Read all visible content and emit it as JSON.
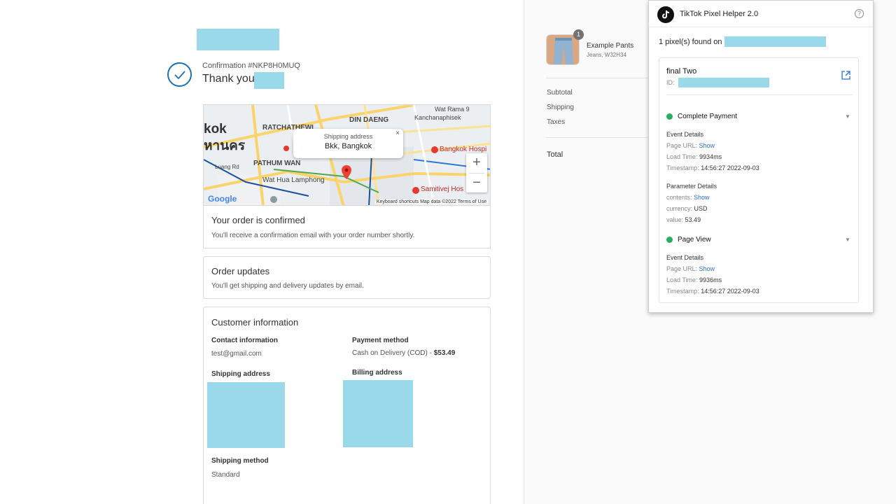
{
  "order": {
    "confirmation": "Confirmation #NKP8H0MUQ",
    "thank_you": "Thank you"
  },
  "map": {
    "popup_label": "Shipping address",
    "popup_value": "Bkk, Bangkok",
    "popup_close": "×",
    "zoom_in": "+",
    "zoom_out": "−",
    "labels": {
      "ratchathewi": "RATCHATHEWI",
      "din_daeng": "DIN DAENG",
      "pathum_wan": "PATHUM WAN",
      "wat_hua_lamphong": "Wat Hua Lamphong",
      "kanchanaphisek": "Kanchanaphisek",
      "wat_rama": "Wat Rama 9",
      "bangkok_hospital": "Bangkok Hospi",
      "samitivej": "Samitivej Hos",
      "kok": "kok",
      "thai_big": "หานคร",
      "luang_rd": "Luang Rd"
    },
    "google": "Google",
    "footer": "Keyboard shortcuts   Map data ©2022   Terms of Use"
  },
  "cards": {
    "confirmed_title": "Your order is confirmed",
    "confirmed_text": "You'll receive a confirmation email with your order number shortly.",
    "updates_title": "Order updates",
    "updates_text": "You'll get shipping and delivery updates by email.",
    "customer_title": "Customer information",
    "contact_label": "Contact information",
    "contact_value": "test@gmail.com",
    "payment_label": "Payment method",
    "payment_value": "Cash on Delivery (COD) - ",
    "payment_amount": "$53.49",
    "shipping_address_label": "Shipping address",
    "billing_address_label": "Billing address",
    "shipping_method_label": "Shipping method",
    "shipping_method_value": "Standard"
  },
  "summary": {
    "badge": "1",
    "product_name": "Example Pants",
    "product_variant": "Jeans, W32H34",
    "subtotal": "Subtotal",
    "shipping": "Shipping",
    "taxes": "Taxes",
    "total": "Total"
  },
  "extension": {
    "title": "TikTok Pixel Helper 2.0",
    "help": "?",
    "found": "1 pixel(s) found on",
    "pixel_name": "final Two",
    "id_label": "ID:",
    "event1": {
      "title": "Complete Payment",
      "event_details": "Event Details",
      "page_url_label": "Page URL:",
      "page_url_value": "Show",
      "load_time_label": "Load Time:",
      "load_time_value": "9934ms",
      "timestamp_label": "Timestamp:",
      "timestamp_value": "14:56:27 2022-09-03",
      "param_details": "Parameter Details",
      "contents_label": "contents:",
      "contents_value": "Show",
      "currency_label": "currency:",
      "currency_value": "USD",
      "value_label": "value:",
      "value_value": "53.49"
    },
    "event2": {
      "title": "Page View",
      "event_details": "Event Details",
      "page_url_label": "Page URL:",
      "page_url_value": "Show",
      "load_time_label": "Load Time:",
      "load_time_value": "9936ms",
      "timestamp_label": "Timestamp:",
      "timestamp_value": "14:56:27 2022-09-03"
    }
  },
  "colors": {
    "accent_blue": "#1c6fb5",
    "redaction": "#99d9ea",
    "event_green": "#27ae60",
    "link_blue": "#2b6cd4"
  }
}
